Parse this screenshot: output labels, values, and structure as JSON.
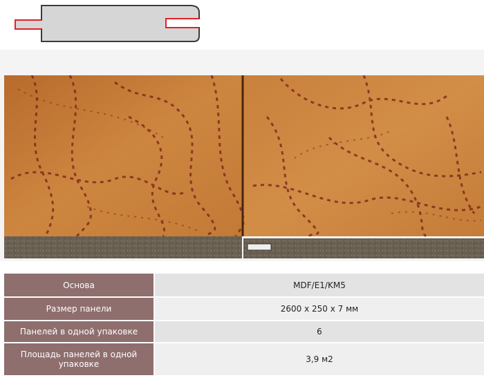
{
  "images": {
    "profile": "panel-profile-icon",
    "photo": "oak-laminate-panel-photo"
  },
  "specs": [
    {
      "label": "Основа",
      "value": "MDF/E1/KM5"
    },
    {
      "label": "Размер панели",
      "value": "2600 х 250 х 7 мм"
    },
    {
      "label": "Панелей в одной упаковке",
      "value": "6"
    },
    {
      "label": "Площадь панелей в одной упаковке",
      "value": "3,9 м2"
    }
  ],
  "colors": {
    "label_bg": "#8f6e6e",
    "value_bg": "#e3e3e3",
    "wood": "#c47a36",
    "grain": "#7a1f16",
    "profile_accent": "#e0202a"
  }
}
